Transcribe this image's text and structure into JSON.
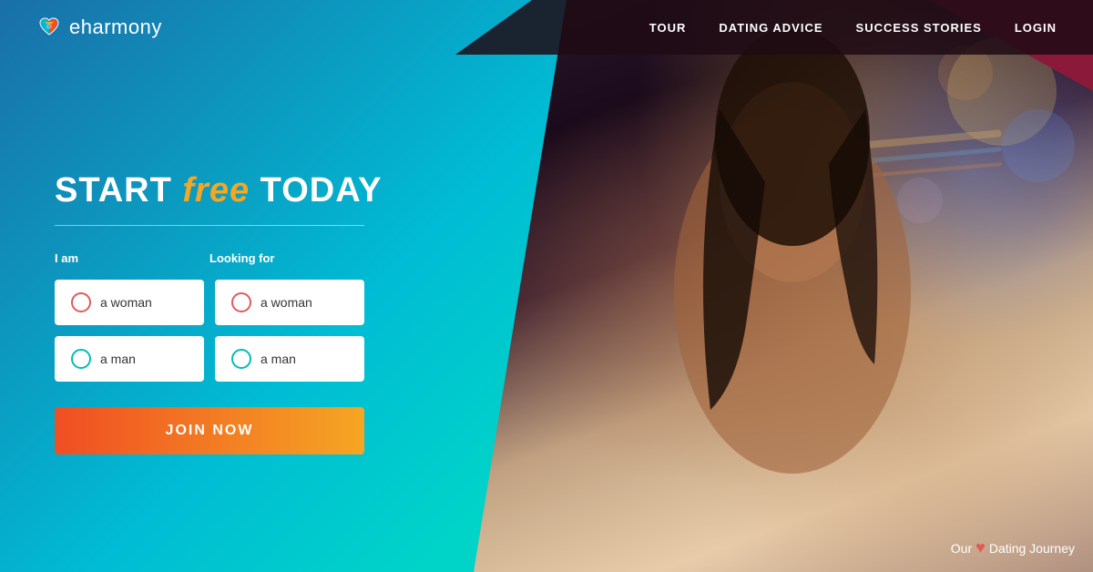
{
  "site": {
    "logo_text": "eharmony"
  },
  "nav": {
    "links": [
      {
        "label": "TOUR",
        "id": "tour"
      },
      {
        "label": "DATING ADVICE",
        "id": "dating-advice"
      },
      {
        "label": "SUCCESS STORIES",
        "id": "success-stories"
      },
      {
        "label": "LOGIN",
        "id": "login"
      }
    ]
  },
  "hero": {
    "headline_start": "START ",
    "headline_free": "free",
    "headline_end": " TODAY"
  },
  "form": {
    "i_am_label": "I am",
    "looking_for_label": "Looking for",
    "i_am_options": [
      {
        "label": "a woman",
        "id": "iam-woman",
        "color": "red"
      },
      {
        "label": "a man",
        "id": "iam-man",
        "color": "teal"
      }
    ],
    "looking_for_options": [
      {
        "label": "a woman",
        "id": "lf-woman",
        "color": "red"
      },
      {
        "label": "a man",
        "id": "lf-man",
        "color": "teal"
      }
    ],
    "join_button": "JOIN NOW"
  },
  "watermark": {
    "prefix": "Our",
    "suffix": "Dating Journey"
  }
}
